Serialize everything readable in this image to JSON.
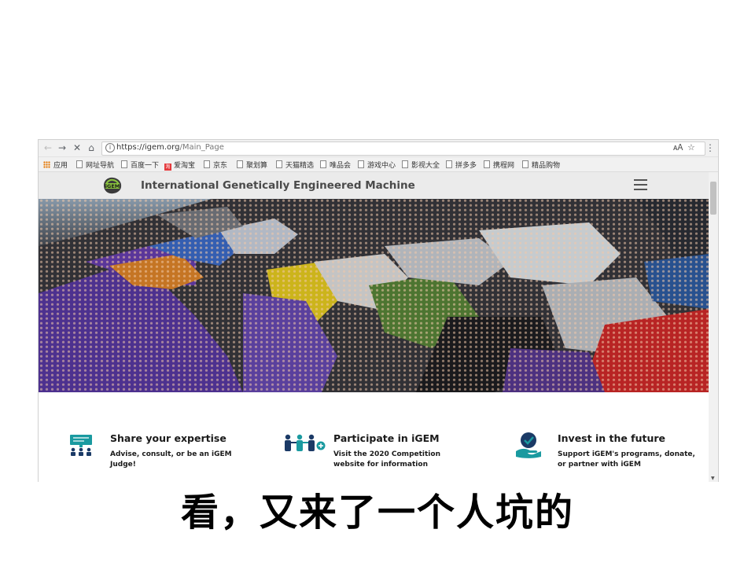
{
  "browser": {
    "url_host": "https://igem.org",
    "url_path": "/Main_Page",
    "bookmarks": [
      "应用",
      "网址导航",
      "百度一下",
      "爱淘宝",
      "京东",
      "聚划算",
      "天猫精选",
      "唯品会",
      "游戏中心",
      "影视大全",
      "拼多多",
      "携程网",
      "精品购物"
    ],
    "taobao_badge": "淘"
  },
  "site": {
    "title": "International Genetically Engineered Machine",
    "logo_text": "iGEM"
  },
  "features": [
    {
      "title": "Share your expertise",
      "desc": "Advise, consult, or be an iGEM Judge!",
      "icon": "presentation-icon"
    },
    {
      "title": "Participate in iGEM",
      "desc": "Visit the 2020 Competition website for information",
      "icon": "people-icon"
    },
    {
      "title": "Invest in the future",
      "desc": "Support iGEM's programs, donate, or partner with iGEM",
      "icon": "hand-heart-icon"
    }
  ],
  "caption": "看，又来了一个人坑的",
  "colors": {
    "accent_teal": "#1a9aa0",
    "icon_navy": "#1b3a66",
    "header_bg": "#ebebeb"
  }
}
